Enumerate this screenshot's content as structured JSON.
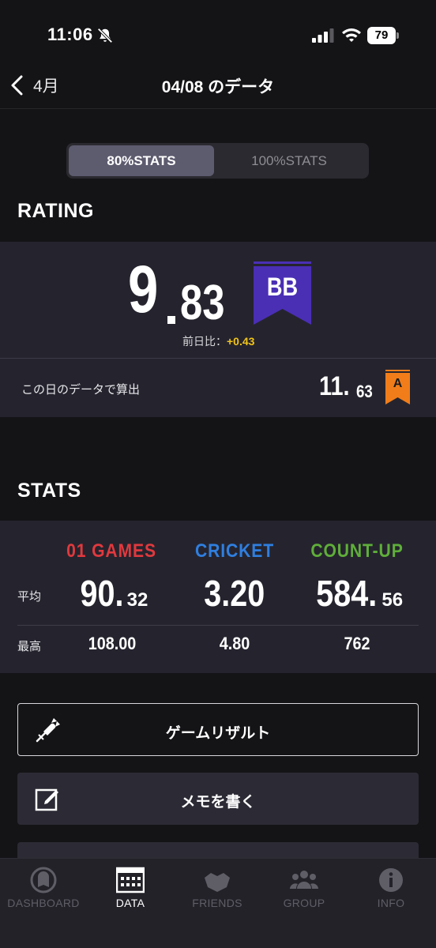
{
  "status_bar": {
    "time": "11:06",
    "battery": "79"
  },
  "nav": {
    "back_label": "4月",
    "title": "04/08 のデータ"
  },
  "stats_toggle": {
    "options": [
      "80%STATS",
      "100%STATS"
    ],
    "selected": "80%STATS"
  },
  "rating": {
    "section_title": "RATING",
    "value_int": "9",
    "value_dec": "83",
    "flag": "BB",
    "flag_color": "#4a2fb5",
    "prev_day_label": "前日比：",
    "prev_day_delta": "+0.43",
    "day_calc_label": "この日のデータで算出",
    "day_value_int": "11.",
    "day_value_dec": "63",
    "day_flag": "A",
    "day_flag_color": "#f07d1a"
  },
  "stats": {
    "section_title": "STATS",
    "row_labels": {
      "avg": "平均",
      "max": "最高"
    },
    "columns": [
      {
        "name": "01 GAMES",
        "color": "#e0393e",
        "avg_int": "90.",
        "avg_dec": "32",
        "max": "108.00"
      },
      {
        "name": "CRICKET",
        "color": "#2f7fe0",
        "avg_int": "3.20",
        "avg_dec": "",
        "max": "4.80"
      },
      {
        "name": "COUNT-UP",
        "color": "#5fae3a",
        "avg_int": "584.",
        "avg_dec": "56",
        "max": "762"
      }
    ]
  },
  "actions": {
    "game_result": "ゲームリザルト",
    "write_memo": "メモを書く"
  },
  "tabs": [
    {
      "label": "DASHBOARD",
      "icon": "dashboard-icon",
      "active": false
    },
    {
      "label": "DATA",
      "icon": "data-icon",
      "active": true
    },
    {
      "label": "FRIENDS",
      "icon": "friends-icon",
      "active": false
    },
    {
      "label": "GROUP",
      "icon": "group-icon",
      "active": false
    },
    {
      "label": "INFO",
      "icon": "info-icon",
      "active": false
    }
  ]
}
